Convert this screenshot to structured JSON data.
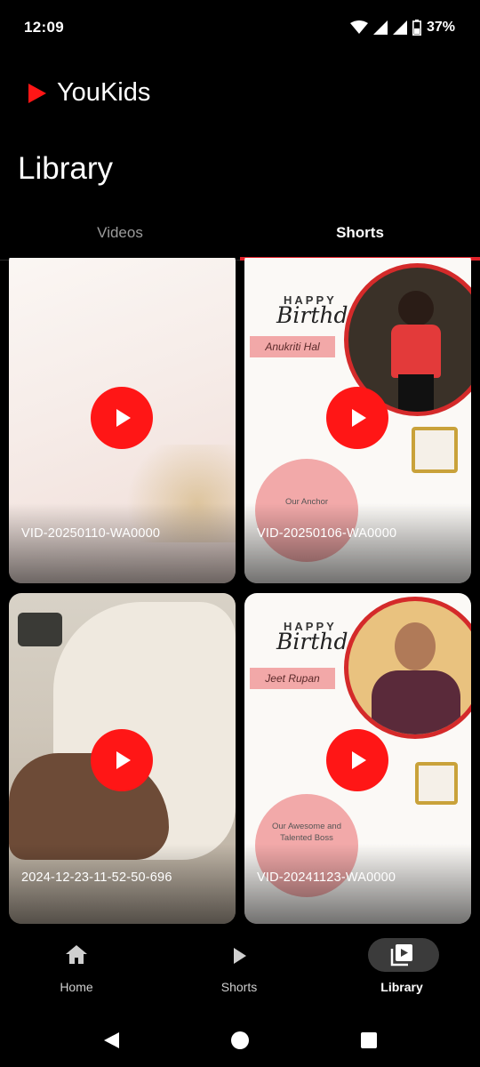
{
  "status_bar": {
    "time": "12:09",
    "battery": "37%"
  },
  "header": {
    "app_name": "YouKids",
    "brand_color": "#ff1616"
  },
  "page": {
    "title": "Library"
  },
  "tabs": [
    {
      "label": "Videos",
      "active": false
    },
    {
      "label": "Shorts",
      "active": true
    }
  ],
  "shorts": [
    {
      "caption": "VID-20250110-WA0000"
    },
    {
      "caption": "VID-20250106-WA0000",
      "card_text": {
        "happy": "HAPPY",
        "birthday": "Birthday!",
        "name": "Anukriti Hal",
        "balloon": "Our Anchor"
      }
    },
    {
      "caption": "2024-12-23-11-52-50-696"
    },
    {
      "caption": "VID-20241123-WA0000",
      "card_text": {
        "happy": "HAPPY",
        "birthday": "Birthday!",
        "name": "Jeet Rupan",
        "balloon": "Our Awesome and Talented Boss"
      }
    }
  ],
  "bottom_nav": [
    {
      "label": "Home",
      "icon": "home-icon",
      "active": false
    },
    {
      "label": "Shorts",
      "icon": "play-icon",
      "active": false
    },
    {
      "label": "Library",
      "icon": "library-icon",
      "active": true
    }
  ],
  "system_nav": {
    "icons": [
      "back-icon",
      "home-circle-icon",
      "recents-icon"
    ]
  }
}
